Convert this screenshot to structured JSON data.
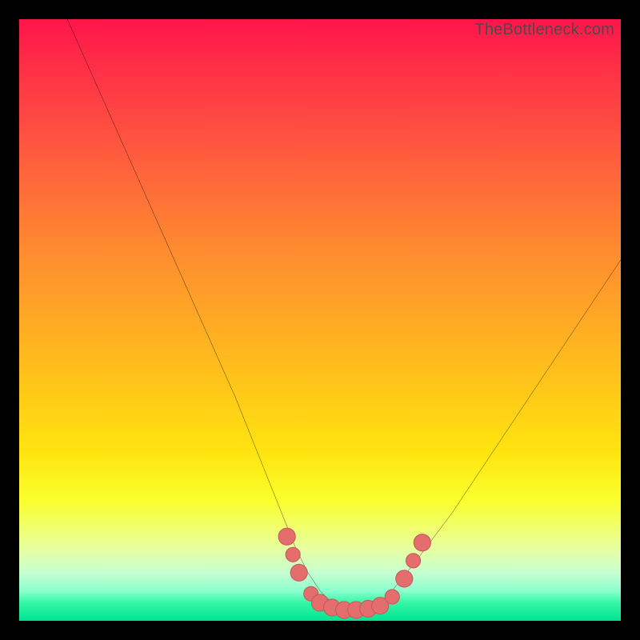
{
  "attribution": "TheBottleneck.com",
  "colors": {
    "frame": "#000000",
    "gradient_top": "#ff154a",
    "gradient_bottom": "#00e492",
    "curve": "#000000",
    "marker_fill": "#e46e6e",
    "marker_stroke": "#c95a5a"
  },
  "chart_data": {
    "type": "line",
    "title": "",
    "xlabel": "",
    "ylabel": "",
    "xlim": [
      0,
      100
    ],
    "ylim": [
      0,
      100
    ],
    "grid": false,
    "series": [
      {
        "name": "bottleneck-curve",
        "x": [
          8,
          12,
          16,
          20,
          24,
          28,
          32,
          36,
          40,
          42,
          44,
          46,
          48,
          50,
          52,
          54,
          56,
          58,
          60,
          62,
          66,
          72,
          80,
          90,
          100
        ],
        "y": [
          100,
          91,
          82,
          73,
          64,
          55,
          46,
          37,
          27,
          22,
          17,
          12,
          8,
          5,
          3,
          2,
          2,
          2,
          3,
          5,
          10,
          18,
          30,
          45,
          60
        ]
      }
    ],
    "markers": [
      {
        "x": 44.5,
        "y": 14,
        "r": 1.4
      },
      {
        "x": 45.5,
        "y": 11,
        "r": 1.2
      },
      {
        "x": 46.5,
        "y": 8,
        "r": 1.4
      },
      {
        "x": 48.5,
        "y": 4.5,
        "r": 1.2
      },
      {
        "x": 50,
        "y": 3,
        "r": 1.4
      },
      {
        "x": 52,
        "y": 2.2,
        "r": 1.4
      },
      {
        "x": 54,
        "y": 1.8,
        "r": 1.4
      },
      {
        "x": 56,
        "y": 1.8,
        "r": 1.4
      },
      {
        "x": 58,
        "y": 2,
        "r": 1.4
      },
      {
        "x": 60,
        "y": 2.5,
        "r": 1.4
      },
      {
        "x": 62,
        "y": 4,
        "r": 1.2
      },
      {
        "x": 64,
        "y": 7,
        "r": 1.4
      },
      {
        "x": 65.5,
        "y": 10,
        "r": 1.2
      },
      {
        "x": 67,
        "y": 13,
        "r": 1.4
      }
    ],
    "annotations": []
  }
}
